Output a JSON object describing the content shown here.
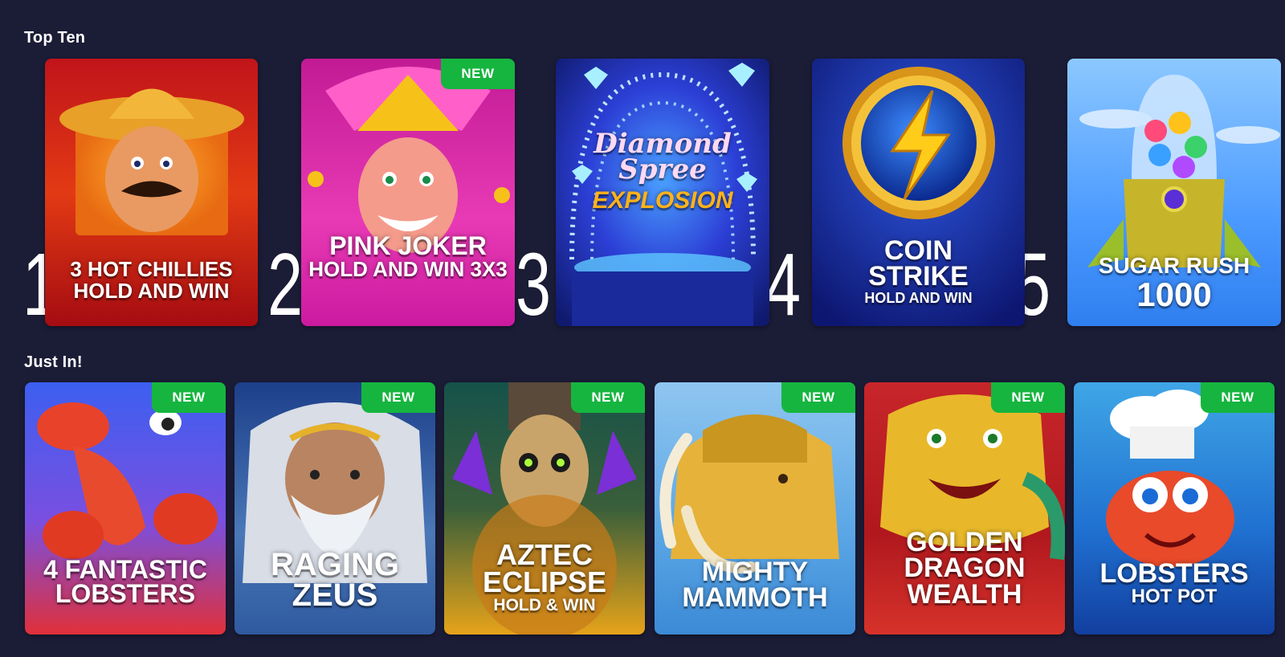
{
  "sections": {
    "top_ten": {
      "title": "Top Ten",
      "games": [
        {
          "rank": "1",
          "name": "3 HOT CHILLIES",
          "sub": "HOLD AND WIN",
          "badge": ""
        },
        {
          "rank": "2",
          "name": "PINK JOKER",
          "sub": "HOLD AND WIN 3X3",
          "badge": "NEW"
        },
        {
          "rank": "3",
          "name": "Diamond Spree",
          "sub": "EXPLOSION",
          "badge": ""
        },
        {
          "rank": "4",
          "name": "COIN STRIKE",
          "sub": "HOLD AND WIN",
          "badge": ""
        },
        {
          "rank": "5",
          "name": "SUGAR RUSH",
          "sub": "1000",
          "badge": ""
        }
      ]
    },
    "just_in": {
      "title": "Just In!",
      "games": [
        {
          "name": "4 FANTASTIC LOBSTERS",
          "sub": "",
          "badge": "NEW"
        },
        {
          "name": "RAGING ZEUS",
          "sub": "",
          "badge": "NEW"
        },
        {
          "name": "AZTEC ECLIPSE",
          "sub": "HOLD & WIN",
          "badge": "NEW"
        },
        {
          "name": "MIGHTY MAMMOTH",
          "sub": "",
          "badge": "NEW"
        },
        {
          "name": "GOLDEN DRAGON WEALTH",
          "sub": "",
          "badge": "NEW"
        },
        {
          "name": "LOBSTERS",
          "sub": "HOT POT",
          "badge": "NEW"
        }
      ]
    }
  },
  "colors": {
    "background": "#1b1c36",
    "badge": "#16b53f"
  }
}
